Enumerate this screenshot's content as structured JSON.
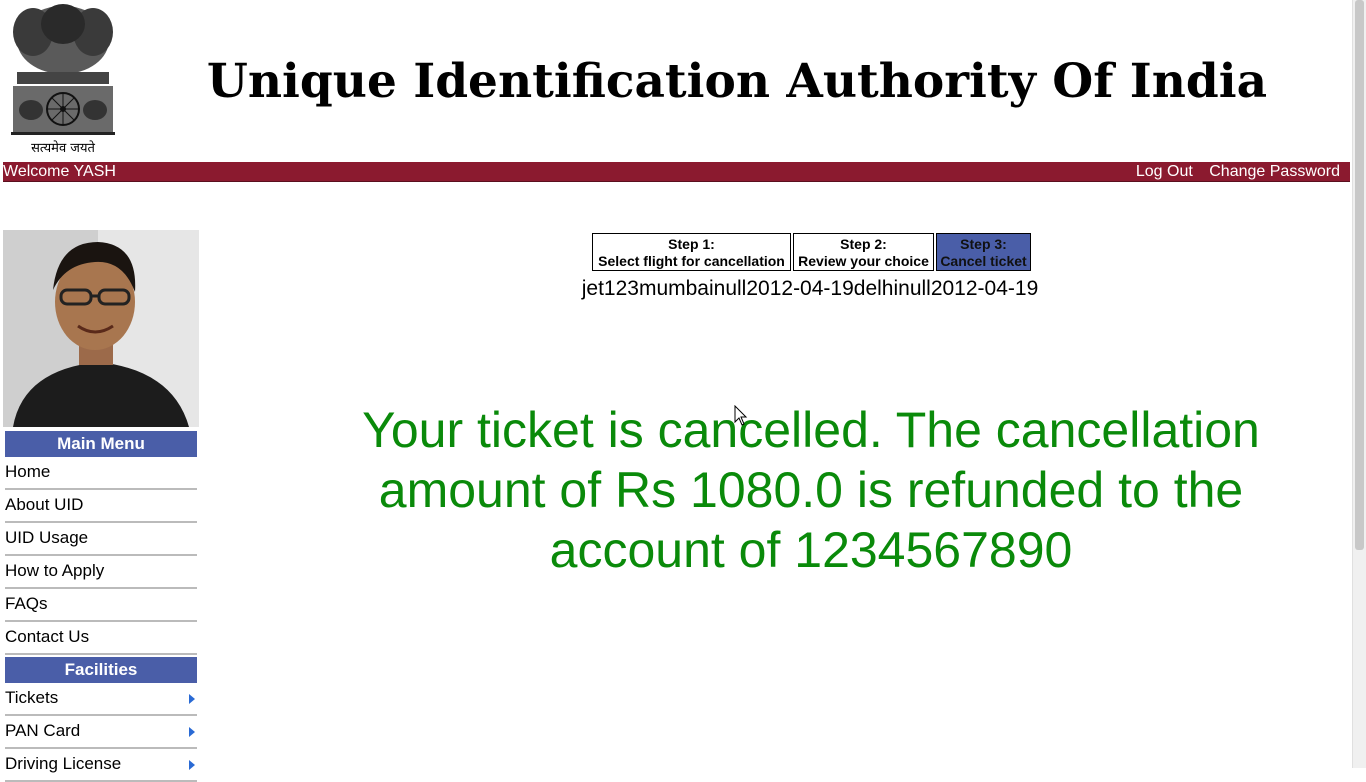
{
  "header": {
    "title": "Unique Identification Authority Of India",
    "emblem_motto": "सत्यमेव जयते"
  },
  "topbar": {
    "welcome": "Welcome YASH",
    "logout": "Log Out",
    "change_password": "Change Password"
  },
  "sidebar": {
    "main_menu_title": "Main Menu",
    "main_menu": [
      {
        "label": "Home"
      },
      {
        "label": "About UID"
      },
      {
        "label": "UID Usage"
      },
      {
        "label": "How to Apply"
      },
      {
        "label": "FAQs"
      },
      {
        "label": "Contact Us"
      }
    ],
    "facilities_title": "Facilities",
    "facilities": [
      {
        "label": "Tickets"
      },
      {
        "label": "PAN Card"
      },
      {
        "label": "Driving License"
      }
    ]
  },
  "steps": [
    {
      "title": "Step 1:",
      "desc": "Select flight for cancellation",
      "active": false
    },
    {
      "title": "Step 2:",
      "desc": "Review your choice",
      "active": false
    },
    {
      "title": "Step 3:",
      "desc": "Cancel ticket",
      "active": true
    }
  ],
  "ticket_line": "jet123mumbainull2012-04-19delhinull2012-04-19",
  "message": "Your ticket is cancelled. The cancellation amount of Rs 1080.0 is refunded to the account of 1234567890",
  "colors": {
    "topbar": "#8b1a2f",
    "menu_header": "#4a5ea8",
    "message": "#0a8a0a"
  }
}
